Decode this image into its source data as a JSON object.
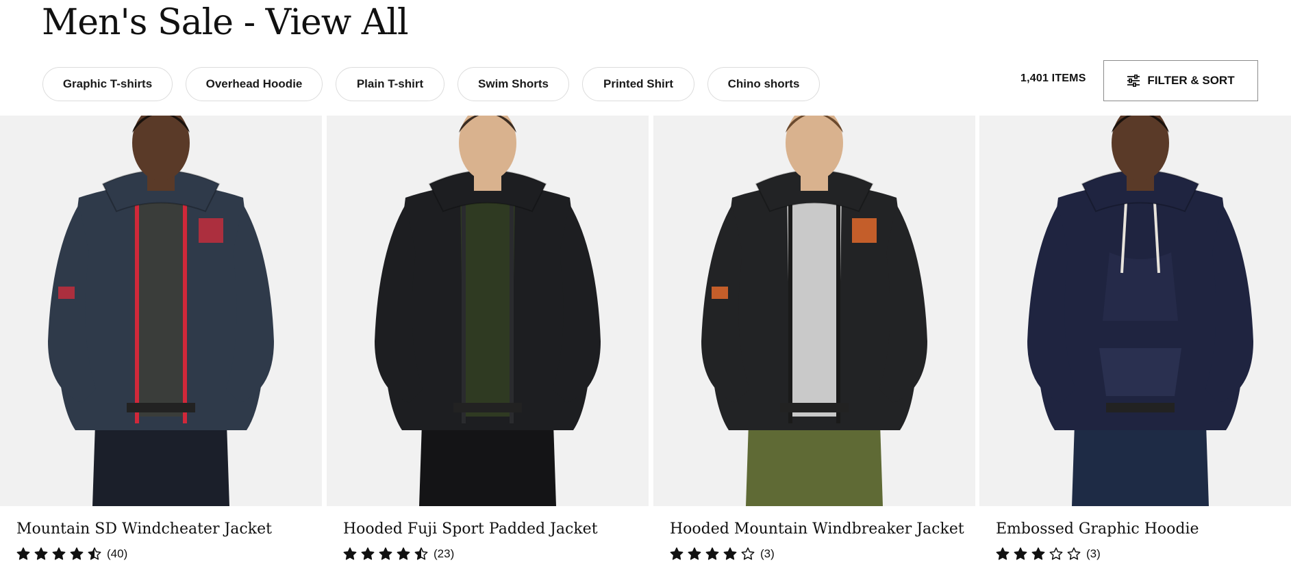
{
  "header": {
    "title": "Men's Sale - View All"
  },
  "filters": {
    "chips": [
      {
        "label": "Graphic T-shirts"
      },
      {
        "label": "Overhead Hoodie"
      },
      {
        "label": "Plain T-shirt"
      },
      {
        "label": "Swim Shorts"
      },
      {
        "label": "Printed Shirt"
      },
      {
        "label": "Chino shorts"
      }
    ],
    "item_count": "1,401 ITEMS",
    "filter_sort_label": "FILTER & SORT",
    "filter_icon": "sliders-icon"
  },
  "products": [
    {
      "name": "Mountain SD Windcheater Jacket",
      "rating": 4.5,
      "reviews": "(40)",
      "colors": {
        "jacket": "#2f3a4a",
        "inner": "#3a3d3a",
        "trim": "#d0283a",
        "pants": "#1b1f2a",
        "accent": "#c22e3c"
      }
    },
    {
      "name": "Hooded Fuji Sport Padded Jacket",
      "rating": 4.5,
      "reviews": "(23)",
      "colors": {
        "jacket": "#1d1e21",
        "inner": "#2f3a22",
        "trim": "#2a2b2e",
        "pants": "#141416",
        "accent": "#cc2b2b"
      }
    },
    {
      "name": "Hooded Mountain Windbreaker Jacket",
      "rating": 4,
      "reviews": "(3)",
      "colors": {
        "jacket": "#222325",
        "inner": "#c9c9c9",
        "trim": "#1a1a1a",
        "pants": "#5f6a35",
        "accent": "#e0682c"
      }
    },
    {
      "name": "Embossed Graphic Hoodie",
      "rating": 3,
      "reviews": "(3)",
      "colors": {
        "jacket": "#1f2440",
        "inner": "#4a5a6e",
        "trim": "#e8e4dc",
        "pants": "#1e2b45",
        "accent": "#2a3050"
      }
    }
  ]
}
